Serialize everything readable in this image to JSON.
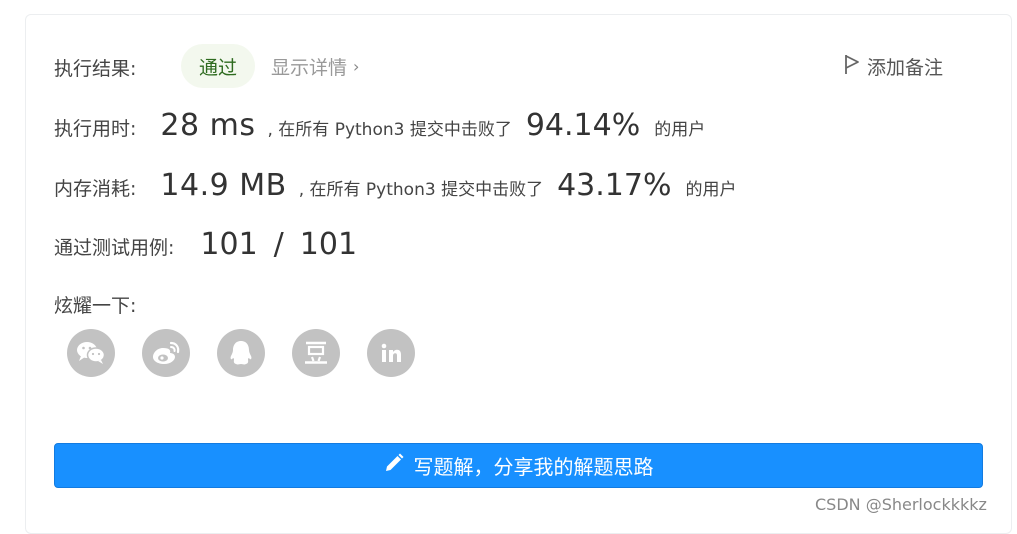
{
  "result": {
    "label": "执行结果:",
    "status": "通过",
    "details_link": "显示详情",
    "add_note": "添加备注"
  },
  "runtime": {
    "label": "执行用时:",
    "value": "28 ms",
    "prefix": ", 在所有 Python3 提交中击败了",
    "percent": "94.14%",
    "suffix": "的用户"
  },
  "memory": {
    "label": "内存消耗:",
    "value": "14.9 MB",
    "prefix": ", 在所有 Python3 提交中击败了",
    "percent": "43.17%",
    "suffix": "的用户"
  },
  "testcases": {
    "label": "通过测试用例:",
    "passed": "101",
    "separator": "/",
    "total": "101"
  },
  "share": {
    "label": "炫耀一下:",
    "icons": [
      "wechat-icon",
      "weibo-icon",
      "qq-icon",
      "douban-icon",
      "linkedin-icon"
    ]
  },
  "solution_button": {
    "label": "写题解，分享我的解题思路",
    "icon": "pencil-icon",
    "color": "#1890ff"
  },
  "watermark": "CSDN @Sherlockkkkz"
}
